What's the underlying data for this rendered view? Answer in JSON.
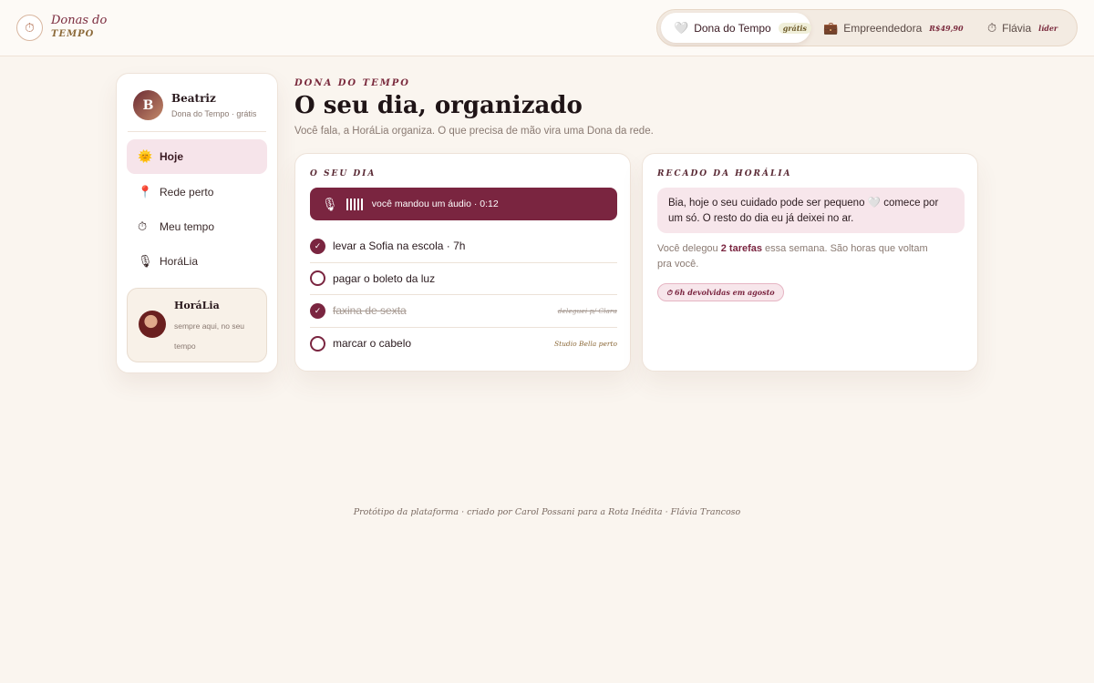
{
  "header": {
    "logo_line1": "Donas do",
    "logo_line2": "TEMPO",
    "logo_icon": "clock-icon",
    "profiles": [
      {
        "label": "Dona do Tempo",
        "tag": "grátis",
        "icon": "heart-icon",
        "active": true
      },
      {
        "label": "Empreendedora",
        "tag": "R$49,90",
        "icon": "briefcase-icon",
        "active": false
      },
      {
        "label": "Flávia",
        "tag": "líder",
        "icon": "timer-icon",
        "active": false
      }
    ]
  },
  "sidebar": {
    "user": {
      "initial": "B",
      "name": "Beatriz",
      "plan": "Dona do Tempo · grátis"
    },
    "items": [
      {
        "label": "Hoje",
        "icon": "sun-icon",
        "active": true
      },
      {
        "label": "Rede perto",
        "icon": "pin-icon",
        "active": false
      },
      {
        "label": "Meu tempo",
        "icon": "stopwatch-icon",
        "active": false
      },
      {
        "label": "HoráLia",
        "icon": "microphone-icon",
        "active": false
      }
    ],
    "assistant": {
      "name": "HoráLia",
      "subtitle": "sempre aqui, no seu tempo"
    }
  },
  "main": {
    "eyebrow": "DONA DO TEMPO",
    "title": "O seu dia, organizado",
    "subtitle": "Você fala, a HoráLia organiza. O que precisa de mão vira uma Dona da rede."
  },
  "day_card": {
    "title": "O SEU DIA",
    "audio": "você mandou um áudio · 0:12",
    "tasks": [
      {
        "label": "levar a Sofia na escola · 7h",
        "done": true,
        "struck": false,
        "note": ""
      },
      {
        "label": "pagar o boleto da luz",
        "done": false,
        "struck": false,
        "note": ""
      },
      {
        "label": "faxina de sexta",
        "done": true,
        "struck": true,
        "note": "deleguei p/ Clara"
      },
      {
        "label": "marcar o cabelo",
        "done": false,
        "struck": false,
        "note": "Studio Bella perto"
      }
    ]
  },
  "note_card": {
    "title": "RECADO DA HORÁLIA",
    "bubble_part1": "Bia, hoje o seu cuidado pode ser pequeno ",
    "bubble_part2": " comece por um só. O resto do dia eu já deixei no ar.",
    "text_before": "Você delegou ",
    "text_bold": "2 tarefas",
    "text_after": " essa semana. São horas que voltam pra você.",
    "badge": "⏱ 6h devolvidas em agosto"
  },
  "footer": "Protótipo da plataforma · criado por Carol Possani para a Rota Inédita · Flávia Trancoso",
  "colors": {
    "accent": "#7a2540",
    "background": "#faf5ef",
    "bubble": "#f7e6eb"
  }
}
